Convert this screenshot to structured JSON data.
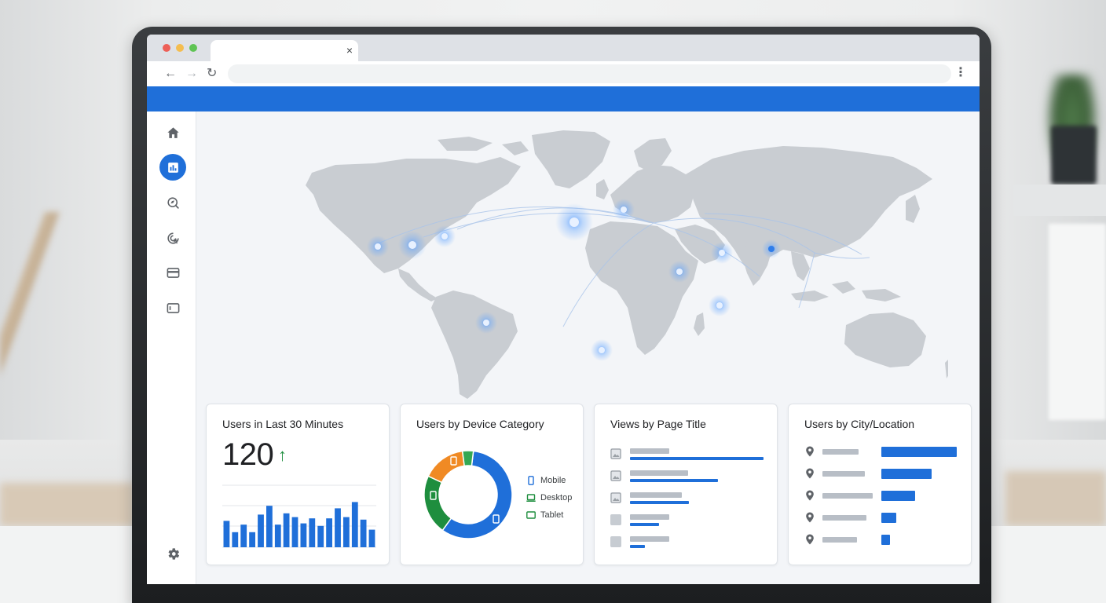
{
  "browser": {
    "tab_close": "×",
    "back": "←",
    "forward": "→",
    "reload": "↻",
    "menu": "⋮"
  },
  "colors": {
    "brand_blue": "#1f6fd9",
    "positive_green": "#1e8e3e",
    "mobile": "#1f6fd9",
    "desktop": "#1e8e3e",
    "tablet": "#f08a24"
  },
  "sidebar": {
    "items": [
      {
        "icon": "home-icon",
        "active": false
      },
      {
        "icon": "bar-chart-icon",
        "active": true
      },
      {
        "icon": "explore-icon",
        "active": false
      },
      {
        "icon": "advertising-icon",
        "active": false
      },
      {
        "icon": "credit-card-icon",
        "active": false
      },
      {
        "icon": "list-icon",
        "active": false
      }
    ],
    "footer_icon": "gear-icon"
  },
  "map": {
    "hotspots": [
      "north-america-west",
      "north-america-central",
      "north-america-east",
      "south-america",
      "western-europe",
      "eastern-europe",
      "india",
      "china",
      "japan",
      "southeast-asia",
      "southern-africa"
    ]
  },
  "cards": {
    "realtime": {
      "title": "Users in Last 30 Minutes",
      "value": "120",
      "trend": "↑",
      "bars": [
        0.42,
        0.24,
        0.36,
        0.24,
        0.52,
        0.66,
        0.36,
        0.54,
        0.48,
        0.38,
        0.46,
        0.34,
        0.46,
        0.62,
        0.48,
        0.72,
        0.44,
        0.28
      ]
    },
    "device": {
      "title": "Users by Device Category",
      "legend": [
        {
          "label": "Mobile",
          "icon": "phone-icon"
        },
        {
          "label": "Desktop",
          "icon": "laptop-icon"
        },
        {
          "label": "Tablet",
          "icon": "tablet-icon"
        }
      ],
      "shares": {
        "mobile": 0.58,
        "desktop": 0.22,
        "tablet": 0.16,
        "other": 0.04
      }
    },
    "pages": {
      "title": "Views by Page Title",
      "rows": [
        {
          "icon": "image-icon",
          "value": 1.0
        },
        {
          "icon": "image-icon",
          "value": 0.66
        },
        {
          "icon": "image-icon",
          "value": 0.44
        },
        {
          "icon": "blank-icon",
          "value": 0.22
        },
        {
          "icon": "blank-icon",
          "value": 0.11
        }
      ]
    },
    "cities": {
      "title": "Users by City/Location",
      "rows": [
        {
          "icon": "location-pin-icon",
          "value": 1.0
        },
        {
          "icon": "location-pin-icon",
          "value": 0.67
        },
        {
          "icon": "location-pin-icon",
          "value": 0.45
        },
        {
          "icon": "location-pin-icon",
          "value": 0.2
        },
        {
          "icon": "location-pin-icon",
          "value": 0.11
        }
      ]
    }
  }
}
